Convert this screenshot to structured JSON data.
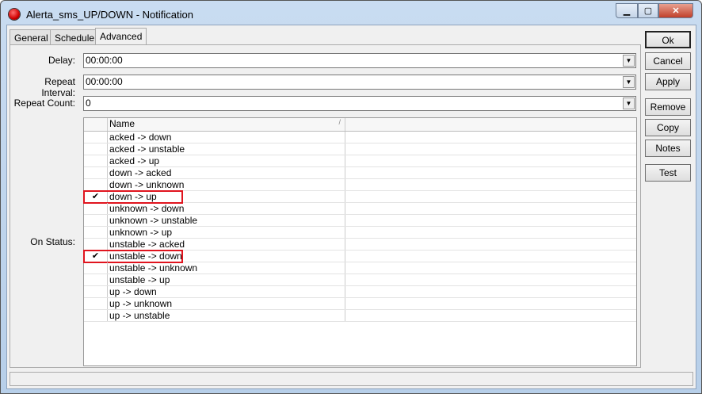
{
  "window": {
    "title": "Alerta_sms_UP/DOWN - Notification",
    "icon": "red-light-icon"
  },
  "tabs": [
    {
      "label": "General"
    },
    {
      "label": "Schedule"
    },
    {
      "label": "Advanced",
      "active": true
    }
  ],
  "fields": {
    "delay": {
      "label": "Delay:",
      "value": "00:00:00"
    },
    "repeat_interval": {
      "label": "Repeat Interval:",
      "value": "00:00:00"
    },
    "repeat_count": {
      "label": "Repeat Count:",
      "value": "0"
    }
  },
  "on_status": {
    "label": "On Status:",
    "column": "Name",
    "sort_indicator": "/",
    "rows": [
      {
        "name": "acked -> down",
        "checked": false
      },
      {
        "name": "acked -> unstable",
        "checked": false
      },
      {
        "name": "acked -> up",
        "checked": false
      },
      {
        "name": "down -> acked",
        "checked": false
      },
      {
        "name": "down -> unknown",
        "checked": false
      },
      {
        "name": "down -> up",
        "checked": true
      },
      {
        "name": "unknown -> down",
        "checked": false
      },
      {
        "name": "unknown -> unstable",
        "checked": false
      },
      {
        "name": "unknown -> up",
        "checked": false
      },
      {
        "name": "unstable -> acked",
        "checked": false
      },
      {
        "name": "unstable -> down",
        "checked": true
      },
      {
        "name": "unstable -> unknown",
        "checked": false
      },
      {
        "name": "unstable -> up",
        "checked": false
      },
      {
        "name": "up -> down",
        "checked": false
      },
      {
        "name": "up -> unknown",
        "checked": false
      },
      {
        "name": "up -> unstable",
        "checked": false
      }
    ]
  },
  "buttons": {
    "ok": "Ok",
    "cancel": "Cancel",
    "apply": "Apply",
    "remove": "Remove",
    "copy": "Copy",
    "notes": "Notes",
    "test": "Test"
  },
  "highlight_color": "#e0141e"
}
